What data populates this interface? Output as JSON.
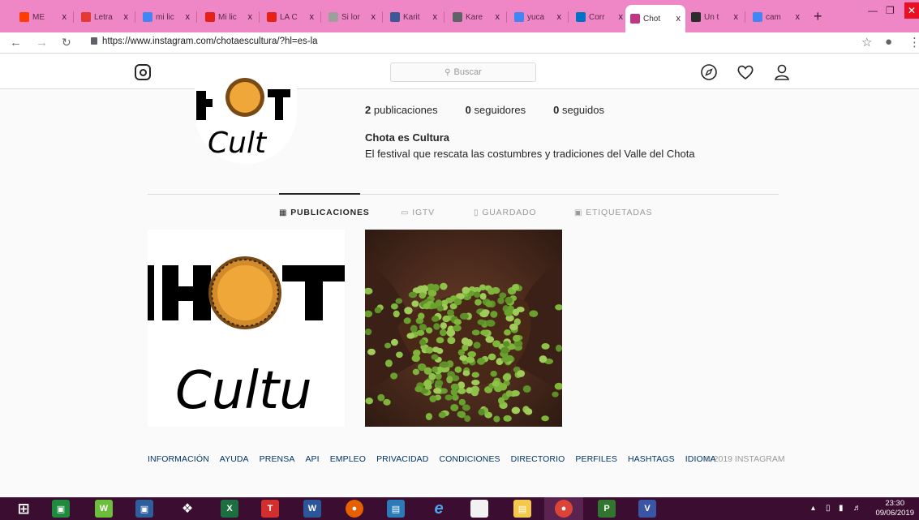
{
  "browser": {
    "tabs": [
      {
        "label": "ME",
        "color": "#ff3d00"
      },
      {
        "label": "Letra",
        "color": "#e53935"
      },
      {
        "label": "mi lic",
        "color": "#4285f4"
      },
      {
        "label": "Mi lic",
        "color": "#e62117"
      },
      {
        "label": "LA C",
        "color": "#e62117"
      },
      {
        "label": "Si lor",
        "color": "#9e9e9e"
      },
      {
        "label": "Karit",
        "color": "#3b5998"
      },
      {
        "label": "Kare",
        "color": "#5f6368"
      },
      {
        "label": "yuca",
        "color": "#4285f4"
      },
      {
        "label": "Corr",
        "color": "#0072c6"
      },
      {
        "label": "Chot",
        "color": "#c13584",
        "active": true
      },
      {
        "label": "Un t",
        "color": "#2c2c2c"
      },
      {
        "label": "cam",
        "color": "#4285f4"
      }
    ],
    "close_glyph": "x",
    "new_tab_glyph": "+",
    "url": "https://www.instagram.com/chotaescultura/?hl=es-la"
  },
  "instagram": {
    "search_placeholder": "Buscar",
    "stats": {
      "posts_count": "2",
      "posts_label": "publicaciones",
      "followers_count": "0",
      "followers_label": "seguidores",
      "following_count": "0",
      "following_label": "seguidos"
    },
    "profile_name": "Chota es Cultura",
    "profile_bio": "El festival que rescata las costumbres y tradiciones del Valle del Chota",
    "avatar_text": "Cult",
    "tabs": [
      {
        "label": "PUBLICACIONES",
        "icon": "grid-icon",
        "active": true
      },
      {
        "label": "IGTV",
        "icon": "igtv-icon"
      },
      {
        "label": "GUARDADO",
        "icon": "bookmark-icon"
      },
      {
        "label": "ETIQUETADAS",
        "icon": "tag-icon"
      }
    ],
    "posts": [
      {
        "kind": "logo",
        "text_top": "HOT",
        "text_bottom": "Cultu"
      },
      {
        "kind": "photo",
        "subject": "hands holding green peas"
      }
    ],
    "footer_links": [
      "INFORMACIÓN",
      "AYUDA",
      "PRENSA",
      "API",
      "EMPLEO",
      "PRIVACIDAD",
      "CONDICIONES",
      "DIRECTORIO",
      "PERFILES",
      "HASHTAGS",
      "IDIOMA"
    ],
    "copyright": "© 2019 INSTAGRAM"
  },
  "taskbar": {
    "time": "23:30",
    "date": "09/06/2019"
  }
}
